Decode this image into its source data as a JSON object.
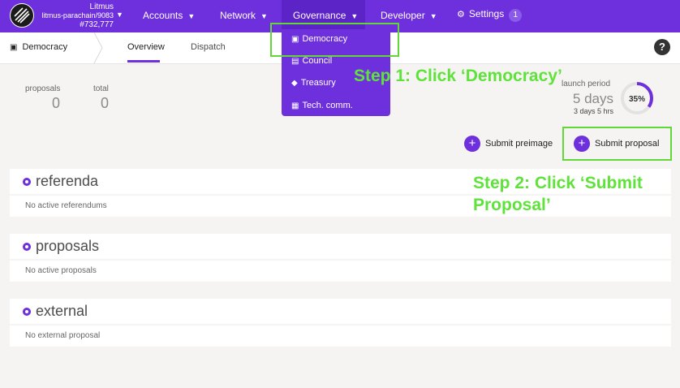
{
  "topbar": {
    "chain_name": "Litmus",
    "chain_sub": "litmus-parachain/9083",
    "block": "#732,777",
    "nav": [
      {
        "label": "Accounts"
      },
      {
        "label": "Network"
      },
      {
        "label": "Governance"
      },
      {
        "label": "Developer"
      },
      {
        "label": "Settings",
        "badge": "1"
      }
    ]
  },
  "subbar": {
    "section": "Democracy",
    "tabs": [
      "Overview",
      "Dispatch"
    ],
    "help": "?"
  },
  "dropdown": {
    "items": [
      "Democracy",
      "Council",
      "Treasury",
      "Tech. comm."
    ]
  },
  "summary": {
    "proposals_label": "proposals",
    "proposals_value": "0",
    "total_label": "total",
    "total_value": "0",
    "launch_label": "launch period",
    "launch_days": "5 days",
    "launch_time": "3 days 5 hrs",
    "launch_percent": "35%",
    "launch_fraction": 0.35
  },
  "actions": {
    "preimage": "Submit preimage",
    "proposal": "Submit proposal"
  },
  "sections": [
    {
      "title": "referenda",
      "empty": "No active referendums"
    },
    {
      "title": "proposals",
      "empty": "No active proposals"
    },
    {
      "title": "external",
      "empty": "No external proposal"
    }
  ],
  "annotations": {
    "step1": "Step 1: Click ‘Democracy’",
    "step2_line1": "Step 2: Click ‘Submit",
    "step2_line2": "Proposal’"
  },
  "colors": {
    "accent": "#6e30dc",
    "highlight": "#62d838"
  }
}
